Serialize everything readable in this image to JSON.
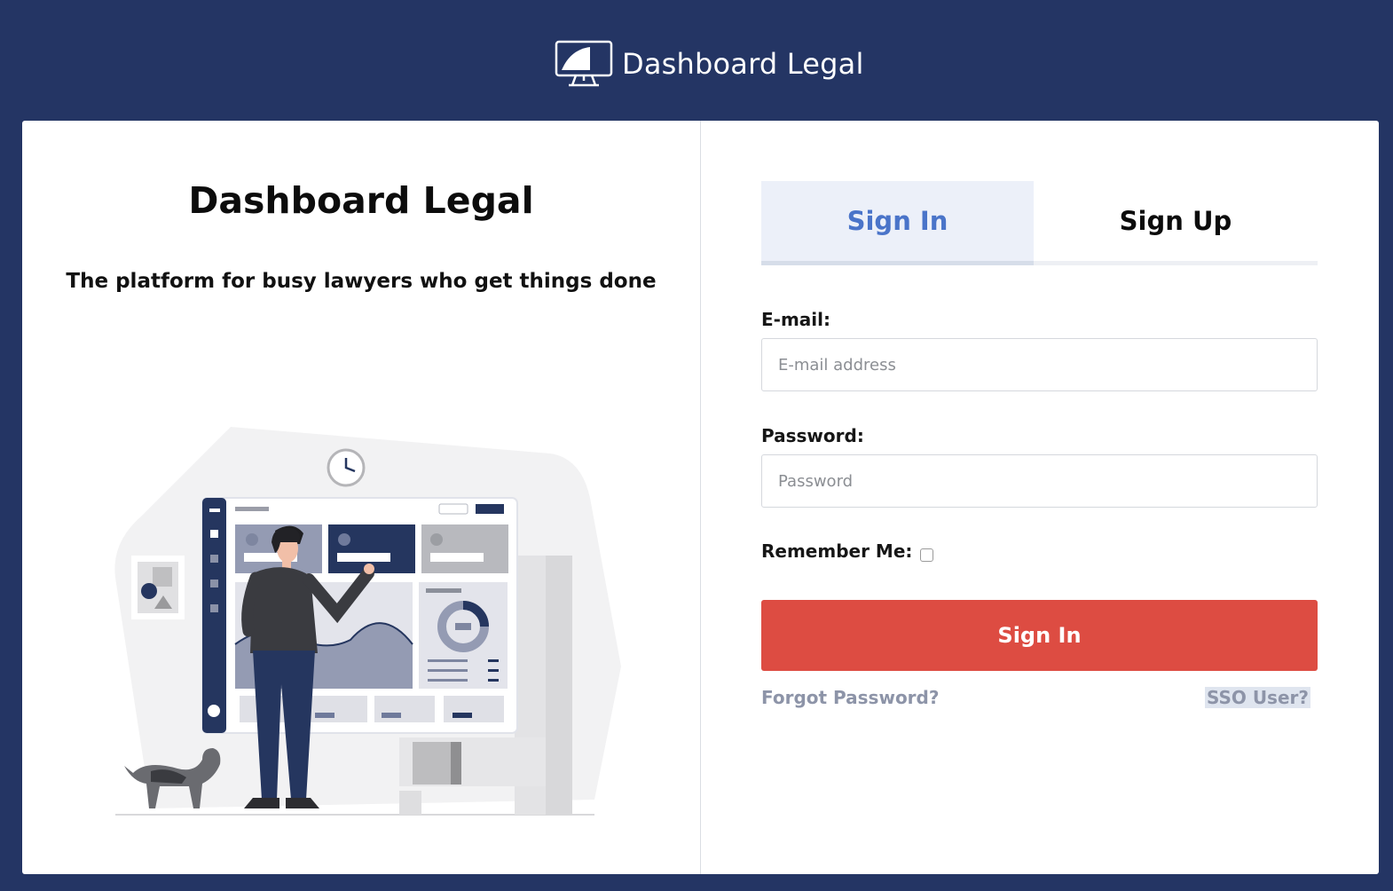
{
  "header": {
    "brand_name": "Dashboard Legal",
    "logo_icon": "monitor-icon"
  },
  "left": {
    "title": "Dashboard Legal",
    "subtitle": "The platform for busy lawyers who get things done",
    "illustration": "person-presenting-dashboard-illustration"
  },
  "auth": {
    "tabs": [
      {
        "label": "Sign In",
        "active": true
      },
      {
        "label": "Sign Up",
        "active": false
      }
    ],
    "email_label": "E-mail:",
    "email_placeholder": "E-mail address",
    "email_value": "",
    "password_label": "Password:",
    "password_placeholder": "Password",
    "password_value": "",
    "remember_label": "Remember Me:",
    "remember_checked": false,
    "submit_label": "Sign In",
    "forgot_label": "Forgot Password?",
    "sso_label": "SSO User?"
  },
  "colors": {
    "background": "#243564",
    "accent_blue": "#4a74c9",
    "button_red": "#dd4c42",
    "link_gray": "#8d94a8",
    "tab_active_bg": "#ecf0f9"
  }
}
